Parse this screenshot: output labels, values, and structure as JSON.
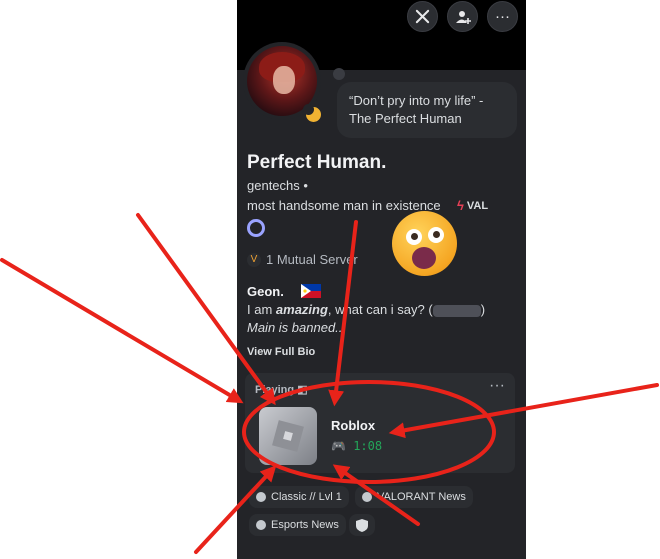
{
  "top_buttons": [
    {
      "icon": "swords-icon"
    },
    {
      "icon": "add-friend-icon",
      "glyph": "⊕"
    },
    {
      "icon": "more-icon",
      "glyph": "···"
    }
  ],
  "custom_status": {
    "line1": "“Don’t pry into my life” -",
    "line2": "The Perfect Human"
  },
  "profile": {
    "display_name": "Perfect Human.",
    "username": "gentechs •",
    "pronouns": "most handsome man in existence",
    "clan_tag": "VAL",
    "status_color": "#f0b232"
  },
  "mutual": {
    "label": "1 Mutual Server",
    "icon": "valorant-icon"
  },
  "bio": {
    "title": "Geon.",
    "line1_pre": "I am ",
    "line1_bold": "amazing",
    "line1_post": ", what can i say? (",
    "line1_end": ")",
    "line2": "Main is banned..",
    "view_full": "View Full Bio"
  },
  "activity": {
    "header": "Playing",
    "more": "···",
    "game_name": "Roblox",
    "elapsed": "1:08",
    "elapsed_color": "#23a559"
  },
  "connections": [
    {
      "label": "Classic // Lvl 1"
    },
    {
      "label": "VALORANT News"
    },
    {
      "label": "Esports News"
    }
  ],
  "annotation": {
    "arrow_color": "#e8231a",
    "emoji": "astonished-face-emoji"
  }
}
